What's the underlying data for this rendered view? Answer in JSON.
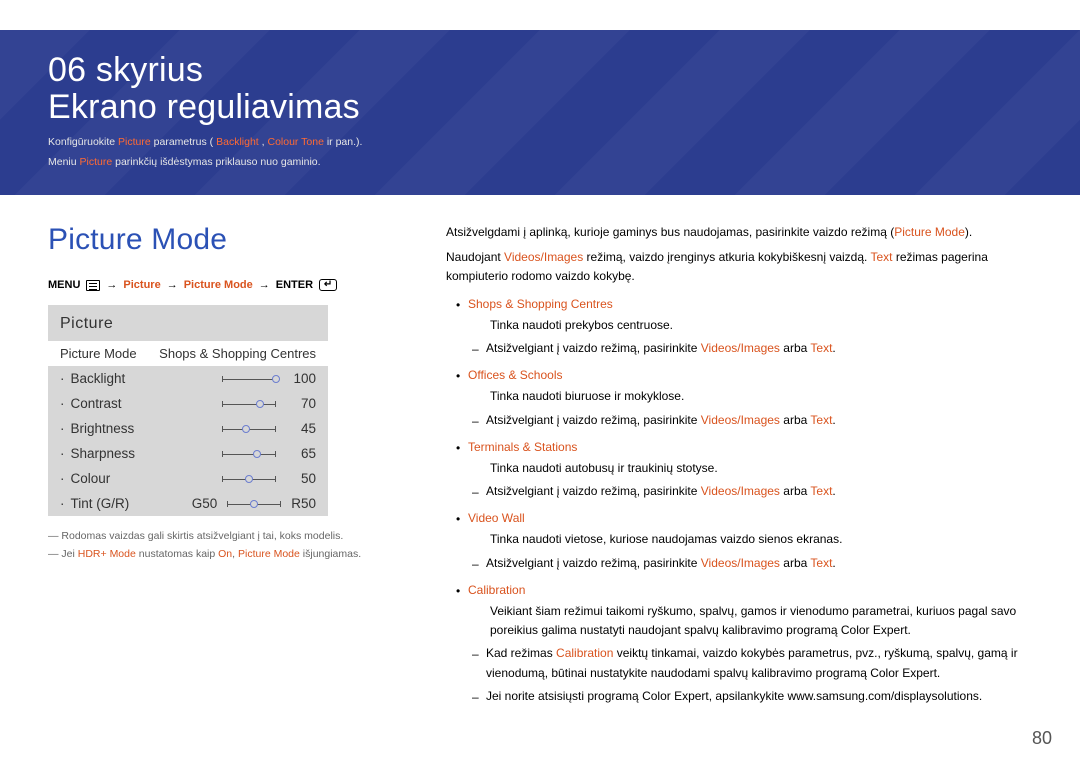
{
  "header": {
    "chapter": "06 skyrius",
    "title": "Ekrano reguliavimas",
    "intro1_pre": "Konfigūruokite ",
    "intro1_picture": "Picture",
    "intro1_mid": " parametrus (",
    "intro1_backlight": "Backlight",
    "intro1_sep": ", ",
    "intro1_colourtone": "Colour Tone",
    "intro1_end": " ir pan.).",
    "intro2_pre": "Meniu ",
    "intro2_picture": "Picture",
    "intro2_end": " parinkčių išdėstymas priklauso nuo gaminio."
  },
  "left": {
    "heading": "Picture Mode",
    "bc": {
      "menu": "MENU",
      "picture": "Picture",
      "mode": "Picture Mode",
      "enter": "ENTER"
    }
  },
  "osd": {
    "title": "Picture",
    "sel_label": "Picture Mode",
    "sel_value": "Shops & Shopping Centres",
    "backlight_l": "Backlight",
    "backlight_v": "100",
    "contrast_l": "Contrast",
    "contrast_v": "70",
    "brightness_l": "Brightness",
    "brightness_v": "45",
    "sharpness_l": "Sharpness",
    "sharpness_v": "65",
    "colour_l": "Colour",
    "colour_v": "50",
    "tint_l": "Tint (G/R)",
    "tint_g": "G50",
    "tint_r": "R50"
  },
  "notes": {
    "n1": "Rodomas vaizdas gali skirtis atsižvelgiant į tai, koks modelis.",
    "n2_pre": "Jei ",
    "n2_hdr": "HDR+ Mode",
    "n2_mid1": " nustatomas kaip ",
    "n2_on": "On",
    "n2_mid2": ", ",
    "n2_pm": "Picture Mode",
    "n2_end": " išjungiamas."
  },
  "right": {
    "p1_pre": "Atsižvelgdami į aplinką, kurioje gaminys bus naudojamas, pasirinkite vaizdo režimą (",
    "p1_pm": "Picture Mode",
    "p1_end": ").",
    "p2_pre": "Naudojant ",
    "p2_vi": "Videos/Images",
    "p2_mid": " režimą, vaizdo įrenginys atkuria kokybiškesnį vaizdą. ",
    "p2_text": "Text",
    "p2_end": " režimas pagerina kompiuterio rodomo vaizdo kokybę.",
    "shops_label": "Shops & Shopping Centres",
    "shops_desc": "Tinka naudoti prekybos centruose.",
    "common_sub_pre": "Atsižvelgiant į vaizdo režimą, pasirinkite ",
    "common_sub_vi": "Videos/Images",
    "common_sub_mid": " arba ",
    "common_sub_text": "Text",
    "common_sub_end": ".",
    "offices_label": "Offices & Schools",
    "offices_desc": "Tinka naudoti biuruose ir mokyklose.",
    "terminals_label": "Terminals & Stations",
    "terminals_desc": "Tinka naudoti autobusų ir traukinių stotyse.",
    "videowall_label": "Video Wall",
    "videowall_desc": "Tinka naudoti vietose, kuriose naudojamas vaizdo sienos ekranas.",
    "calibration_label": "Calibration",
    "calibration_desc": "Veikiant šiam režimui taikomi ryškumo, spalvų, gamos ir vienodumo parametrai, kuriuos pagal savo poreikius galima nustatyti naudojant spalvų kalibravimo programą Color Expert.",
    "calib_sub1_pre": "Kad režimas ",
    "calib_sub1_cal": "Calibration",
    "calib_sub1_end": " veiktų tinkamai, vaizdo kokybės parametrus, pvz., ryškumą, spalvų, gamą ir vienodumą, būtinai nustatykite naudodami spalvų kalibravimo programą Color Expert.",
    "calib_sub2": "Jei norite atsisiųsti programą Color Expert, apsilankykite www.samsung.com/displaysolutions."
  },
  "page_no": "80"
}
